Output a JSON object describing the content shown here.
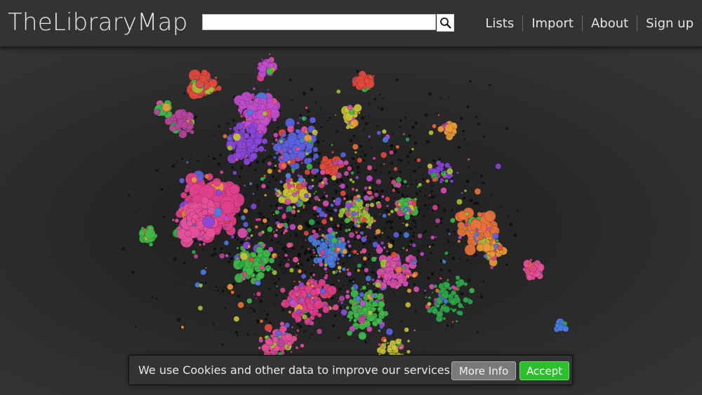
{
  "header": {
    "logo": "TheLibraryMap",
    "search": {
      "value": "",
      "placeholder": ""
    },
    "search_icon": "search-icon",
    "nav": [
      {
        "label": "Lists"
      },
      {
        "label": "Import"
      },
      {
        "label": "About"
      },
      {
        "label": "Sign up"
      }
    ]
  },
  "map": {
    "palette": [
      "#e0408a",
      "#d94fb0",
      "#c24ccf",
      "#8a46d9",
      "#5c62e0",
      "#4a7de0",
      "#e04a3c",
      "#e8733a",
      "#e89a3a",
      "#c9c238",
      "#9fc23a",
      "#3fb84a",
      "#2ea84a",
      "#e6509a",
      "#b4469a"
    ]
  },
  "cookie_banner": {
    "message": "We use Cookies and other data to improve our services.",
    "more_info": "More Info",
    "accept": "Accept"
  },
  "colors": {
    "header_bg": "#333333",
    "accept_green": "#2dbf2d",
    "more_info_gray": "#7a7a7a"
  }
}
